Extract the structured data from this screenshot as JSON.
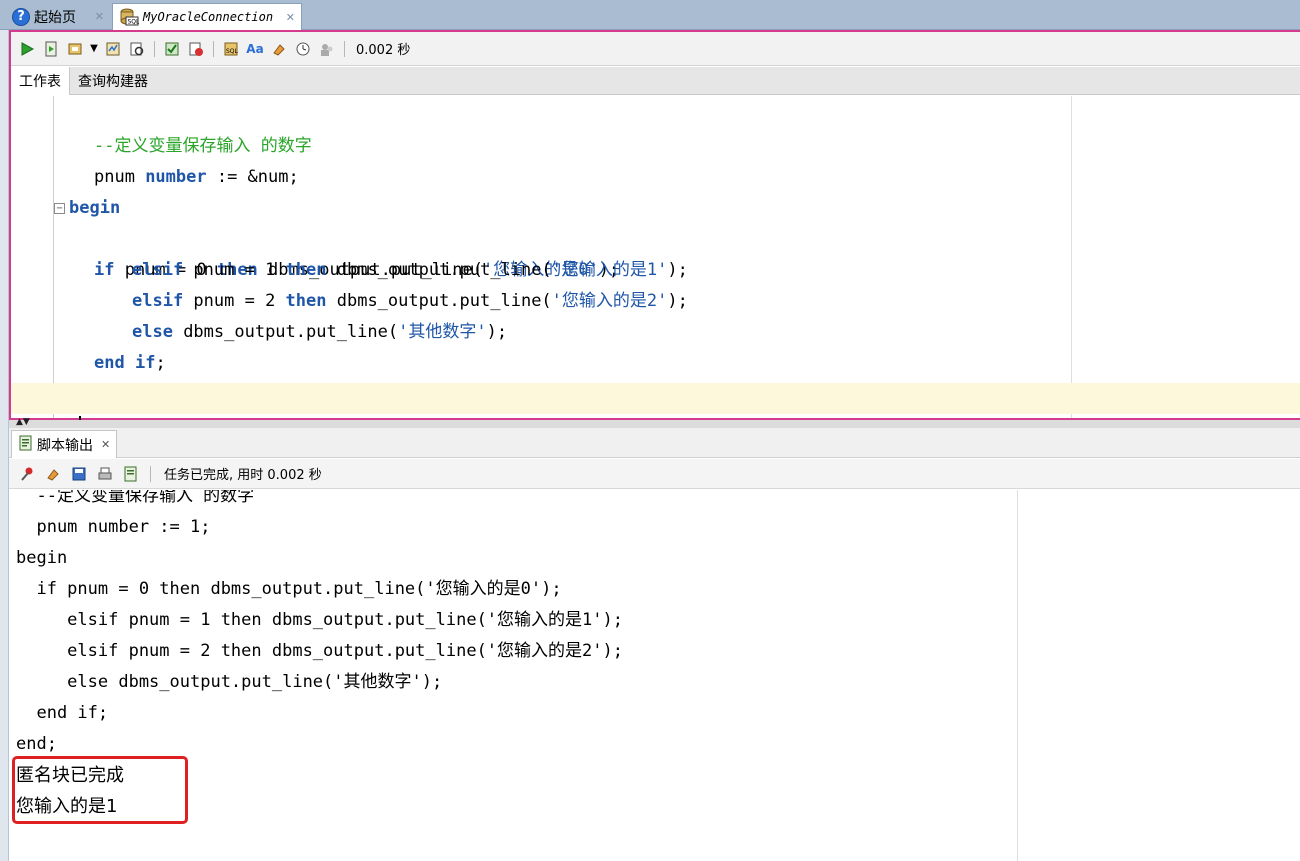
{
  "doc_tabs": [
    {
      "label": "起始页",
      "icon": "help-icon"
    },
    {
      "label": "MyOracleConnection",
      "icon": "sql-worksheet-icon"
    }
  ],
  "toolbar": {
    "timing": "0.002 秒"
  },
  "sub_tabs": [
    "工作表",
    "查询构建器"
  ],
  "output_panel": {
    "tab_label": "脚本输出",
    "status": "任务已完成, 用时 0.002 秒"
  },
  "output_lines": [
    "  --定义变量保存输入 的数字",
    "  pnum number := 1;",
    "begin",
    "  if pnum = 0 then dbms_output.put_line('您输入的是0');",
    "     elsif pnum = 1 then dbms_output.put_line('您输入的是1');",
    "     elsif pnum = 2 then dbms_output.put_line('您输入的是2');",
    "     else dbms_output.put_line('其他数字');",
    "  end if;",
    "end;"
  ],
  "output_messages": [
    "匿名块已完成",
    "您输入的是1"
  ],
  "colors": {
    "keyword": "#1f56a8",
    "comment": "#2aa52a",
    "frame_border": "#d63a8c",
    "highlight": "#e02020"
  },
  "code": {
    "l1": "--定义变量保存输入 的数字",
    "l2a": "pnum ",
    "l2kw": "number",
    "l2b": " := &num;",
    "kw_begin": "begin",
    "kw_if": "if",
    "kw_elsif": "elsif",
    "kw_else": "else",
    "kw_then": "then",
    "kw_end": "end",
    "kw_endif_end": "end",
    "kw_endif_if": "if",
    "kw_final_end": "end",
    "l4a": " pnum = 0 ",
    "l4b": " dbms_output.put_line(",
    "l4s": "'您输入的是0'",
    "l4c": ");",
    "l5a": " pnum = 1 ",
    "l5b": " dbms_output.put_line(",
    "l5s": "'您输入的是1'",
    "l5c": ");",
    "l6a": " pnum = 2 ",
    "l6b": " dbms_output.put_line(",
    "l6s": "'您输入的是2'",
    "l6c": ");",
    "l7b": " dbms_output.put_line(",
    "l7s": "'其他数字'",
    "l7c": ");",
    "semi": ";",
    "space": " ",
    "slash": "/"
  }
}
